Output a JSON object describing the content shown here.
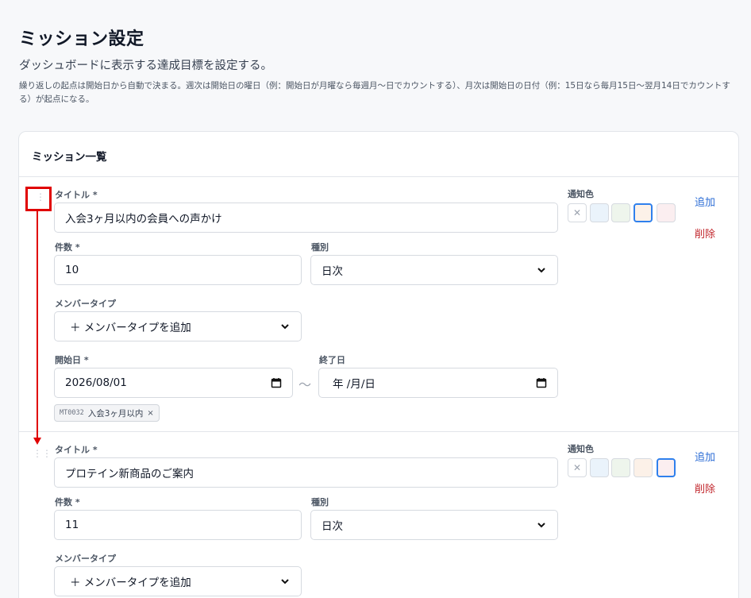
{
  "page": {
    "title": "ミッション設定",
    "subtitle": "ダッシュボードに表示する達成目標を設定する。",
    "help": "繰り返しの起点は開始日から自動で決まる。週次は開始日の曜日（例：開始日が月曜なら毎週月〜日でカウントする）、月次は開始日の日付（例：15日なら毎月15日〜翌月14日でカウントする）が起点になる。"
  },
  "card": {
    "title": "ミッション一覧"
  },
  "labels": {
    "title": "タイトル *",
    "count": "件数 *",
    "type": "種別",
    "member_type": "メンバータイプ",
    "start_date": "開始日 *",
    "end_date": "終了日",
    "notify_color": "通知色",
    "add": "追加",
    "delete": "削除",
    "tilde": "〜",
    "remove": "×"
  },
  "colors": {
    "accent": "#2f80ed",
    "add_link": "#2f6fd6",
    "delete_link": "#c2272d",
    "annotation": "#e00000",
    "swatch_none": "#ffffff",
    "swatch_blue": "#eaf3fb",
    "swatch_green": "#eef5ec",
    "swatch_beige": "#fcf1e8",
    "swatch_pink": "#fbeef0"
  },
  "missions": [
    {
      "title": "入会3ヶ月以内の会員への声かけ",
      "count": "10",
      "type": "日次",
      "member_type_placeholder": "＋ メンバータイプを追加",
      "start_date": "2026/08/01",
      "end_date": "年 /月/日",
      "tag_code": "MT0032",
      "tag_label": "入会3ヶ月以内",
      "selected_color": "beige"
    },
    {
      "title": "プロテイン新商品のご案内",
      "count": "11",
      "type": "日次",
      "member_type_placeholder": "＋ メンバータイプを追加",
      "selected_color": "pink"
    }
  ]
}
